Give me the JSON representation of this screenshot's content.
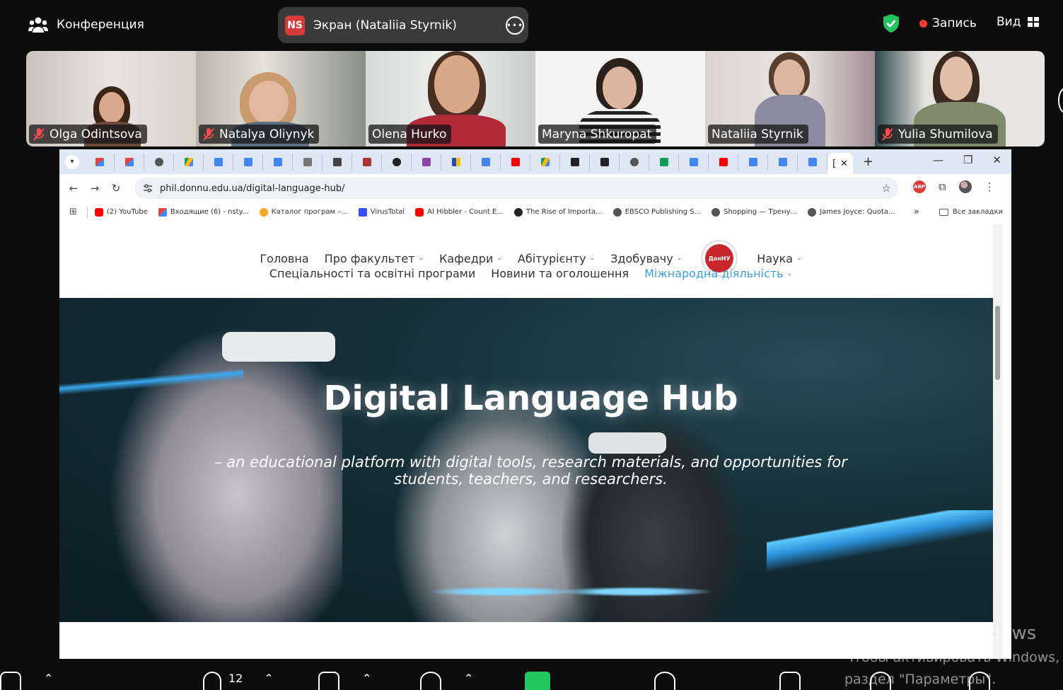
{
  "topbar": {
    "conference_label": "Конференция",
    "share_badge": "NS",
    "share_label": "Экран (Nataliia Styrnik)",
    "record_label": "Запись",
    "view_label": "Вид",
    "colors": {
      "record": "#ff3b30",
      "shield": "#23c55e",
      "share_badge": "#d63a3a"
    }
  },
  "participants": [
    {
      "name": "Olga Odintsova",
      "muted": true
    },
    {
      "name": "Natalya Oliynyk",
      "muted": true
    },
    {
      "name": "Olena Hurko",
      "muted": false,
      "active_speaker": true
    },
    {
      "name": "Maryna Shkuropat",
      "muted": false
    },
    {
      "name": "Nataliia Styrnik",
      "muted": false
    },
    {
      "name": "Yulia Shumilova",
      "muted": true
    }
  ],
  "browser": {
    "url": "phil.donnu.edu.ua/digital-language-hub/",
    "active_tab_label": "[",
    "bookmarks": [
      {
        "label": "(2) YouTube",
        "icon": "youtube-icon"
      },
      {
        "label": "Входящие (6) - nsty...",
        "icon": "gmail-icon"
      },
      {
        "label": "Каталог програм –...",
        "icon": "bulb-icon"
      },
      {
        "label": "VirusTotal",
        "icon": "virustotal-icon"
      },
      {
        "label": "AI Hibbler - Count E...",
        "icon": "youtube-icon"
      },
      {
        "label": "The Rise of Importa...",
        "icon": "site-icon"
      },
      {
        "label": "EBSCO Publishing S...",
        "icon": "globe-icon"
      },
      {
        "label": "Shopping — Трену...",
        "icon": "globe-icon"
      },
      {
        "label": "James Joyce: Quota...",
        "icon": "globe-icon"
      }
    ],
    "bookmarks_more": "»",
    "all_bookmarks": "Все закладки",
    "extension_abp": "ABP"
  },
  "page": {
    "nav_row1": [
      {
        "label": "Головна",
        "caret": false
      },
      {
        "label": "Про факультет",
        "caret": true
      },
      {
        "label": "Кафедри",
        "caret": true
      },
      {
        "label": "Абітурієнту",
        "caret": true
      },
      {
        "label": "Здобувачу",
        "caret": true
      },
      {
        "label": "Наука",
        "caret": true
      }
    ],
    "nav_row2": [
      {
        "label": "Спеціальності та освітні програми",
        "caret": false
      },
      {
        "label": "Новини та оголошення",
        "caret": false
      },
      {
        "label": "Міжнародна діяльність",
        "caret": true,
        "accent": true
      }
    ],
    "logo_text": "ДонНУ",
    "hero": {
      "title": "Digital Language Hub",
      "subtitle": "– an educational platform with digital tools, research materials, and opportunities for students, teachers, and researchers."
    },
    "accent_color": "#3ba1d8"
  },
  "activation": {
    "title": "Активация Windows",
    "line1": "Чтобы активировать Windows,",
    "line2": "раздел \"Параметры\"."
  },
  "bottombar": {
    "participants_count": "12"
  }
}
